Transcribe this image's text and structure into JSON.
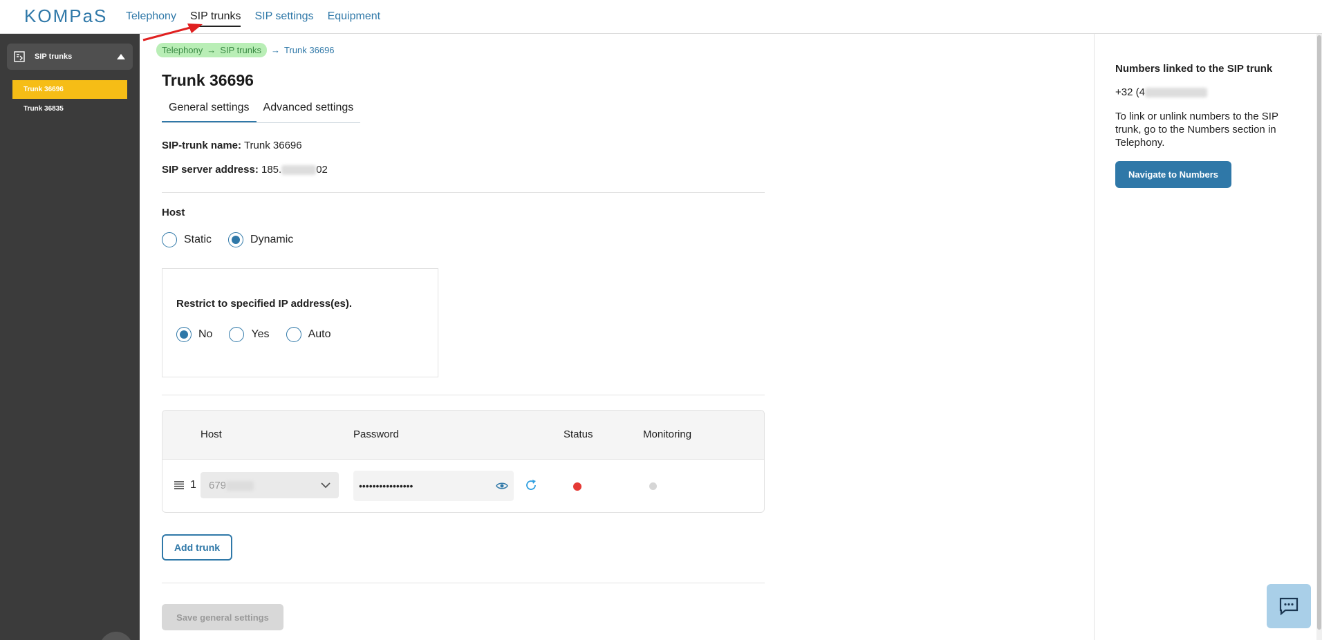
{
  "header": {
    "logo": "KOMPaS",
    "nav": [
      {
        "label": "Telephony",
        "active": false
      },
      {
        "label": "SIP trunks",
        "active": true
      },
      {
        "label": "SIP settings",
        "active": false
      },
      {
        "label": "Equipment",
        "active": false
      }
    ]
  },
  "sidebar": {
    "group_label": "SIP trunks",
    "items": [
      {
        "label": "Trunk 36696",
        "active": true
      },
      {
        "label": "Trunk 36835",
        "active": false
      }
    ]
  },
  "breadcrumb": {
    "items": [
      "Telephony",
      "SIP trunks",
      "Trunk 36696"
    ]
  },
  "page": {
    "title": "Trunk 36696",
    "tabs": [
      {
        "label": "General settings",
        "active": true
      },
      {
        "label": "Advanced settings",
        "active": false
      }
    ],
    "sip_name_label": "SIP-trunk name:",
    "sip_name_value": "Trunk 36696",
    "server_label": "SIP server address:",
    "server_prefix": "185.",
    "server_suffix": "02",
    "host_label": "Host",
    "host_options": [
      {
        "label": "Static",
        "selected": false
      },
      {
        "label": "Dynamic",
        "selected": true
      }
    ],
    "restrict_label": "Restrict to specified IP address(es).",
    "restrict_options": [
      {
        "label": "No",
        "selected": true
      },
      {
        "label": "Yes",
        "selected": false
      },
      {
        "label": "Auto",
        "selected": false
      }
    ]
  },
  "table": {
    "headers": [
      "Host",
      "Password",
      "Status",
      "Monitoring"
    ],
    "rows": [
      {
        "num": "1",
        "host": "679",
        "password": "••••••••••••••••",
        "status_color": "#e53935",
        "monitoring_color": "#d6d6d6"
      }
    ]
  },
  "buttons": {
    "add_trunk": "Add trunk",
    "save": "Save general settings"
  },
  "right_panel": {
    "title": "Numbers linked to the SIP trunk",
    "phone_prefix": "+32 (4",
    "text": "To link or unlink numbers to the SIP trunk, go to the Numbers section in Telephony.",
    "button": "Navigate to Numbers"
  },
  "colors": {
    "accent": "#2f78a8",
    "sidebar_bg": "#3b3b3b",
    "active_item": "#f6bd16",
    "breadcrumb_highlight": "#b9eeb6"
  }
}
